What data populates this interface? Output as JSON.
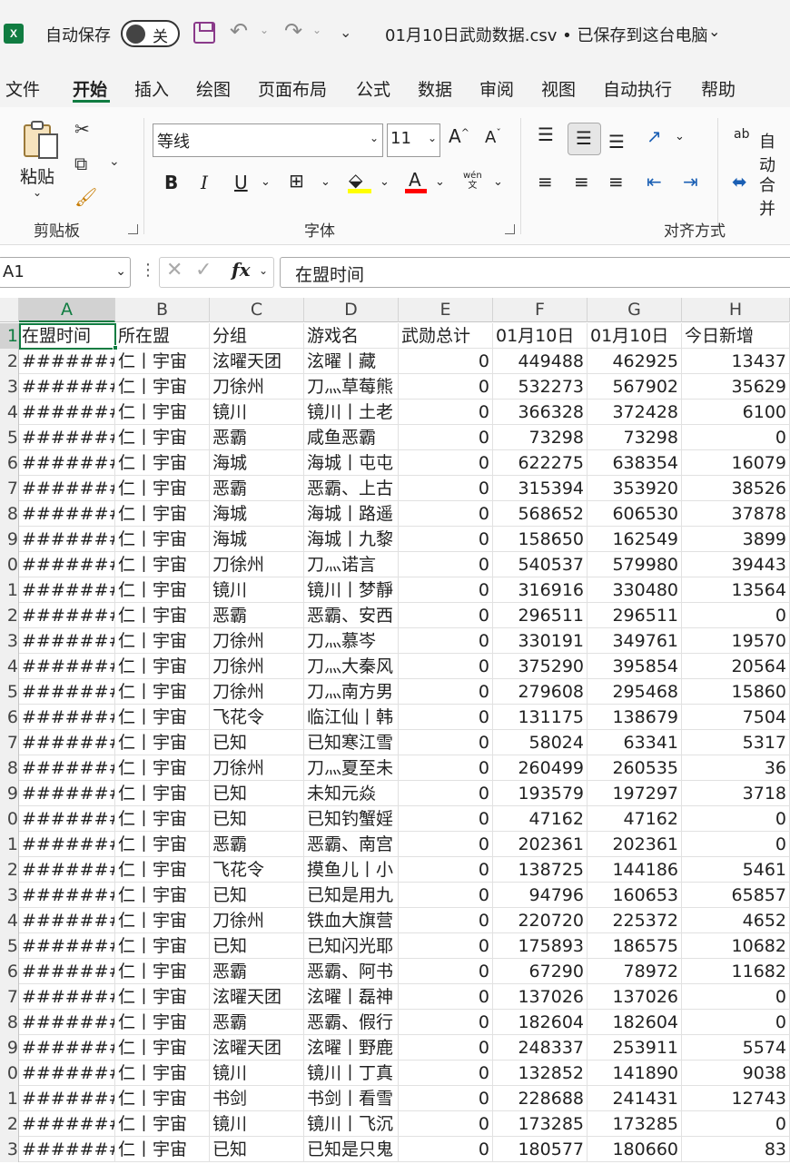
{
  "titlebar": {
    "app_logo": "X",
    "autosave_label": "自动保存",
    "autosave_state": "关",
    "save_icon": "save-icon",
    "undo_icon": "↶",
    "redo_icon": "↷",
    "qat_dropdown": "⌄",
    "document_title": "01月10日武勋数据.csv • 已保存到这台电脑",
    "title_chevron": "⌄"
  },
  "menu": {
    "tabs": [
      "文件",
      "开始",
      "插入",
      "绘图",
      "页面布局",
      "公式",
      "数据",
      "审阅",
      "视图",
      "自动执行",
      "帮助"
    ],
    "active_tab": "开始"
  },
  "ribbon": {
    "clipboard": {
      "paste_label": "粘贴",
      "group_label": "剪贴板"
    },
    "font": {
      "font_name": "等线",
      "font_size": "11",
      "grow_label": "A",
      "shrink_label": "A",
      "bold": "B",
      "italic": "I",
      "underline": "U",
      "font_color_glyph": "A",
      "phonetic_label": "wén",
      "phonetic_sub": "文",
      "group_label": "字体"
    },
    "alignment": {
      "wrap_label": "自动",
      "merge_label": "合并",
      "group_label": "对齐方式"
    }
  },
  "formula_bar": {
    "name_box": "A1",
    "fx_label": "fx",
    "formula": "在盟时间"
  },
  "sheet": {
    "column_letters": [
      "A",
      "B",
      "C",
      "D",
      "E",
      "F",
      "G",
      "H"
    ],
    "row_numbers": [
      "1",
      "2",
      "3",
      "4",
      "5",
      "6",
      "7",
      "8",
      "9",
      "0",
      "1",
      "2",
      "3",
      "4",
      "5",
      "6",
      "7",
      "8",
      "9",
      "0",
      "1",
      "2",
      "3",
      "4",
      "5",
      "6",
      "7",
      "8",
      "9",
      "0",
      "1",
      "2",
      "3"
    ],
    "header": [
      "在盟时间",
      "所在盟",
      "分组",
      "游戏名",
      "武勋总计",
      "01月10日",
      "01月10日",
      "今日新增"
    ],
    "rows": [
      [
        "#######",
        "仁丨宇宙",
        "泫曜天团",
        "泫曜丨藏",
        "0",
        "449488",
        "462925",
        "13437"
      ],
      [
        "#######",
        "仁丨宇宙",
        "刀徐州",
        "刀灬草莓熊",
        "0",
        "532273",
        "567902",
        "35629"
      ],
      [
        "#######",
        "仁丨宇宙",
        "镜川",
        "镜川丨土老",
        "0",
        "366328",
        "372428",
        "6100"
      ],
      [
        "#######",
        "仁丨宇宙",
        "恶霸",
        "咸鱼恶霸",
        "0",
        "73298",
        "73298",
        "0"
      ],
      [
        "#######",
        "仁丨宇宙",
        "海城",
        "海城丨屯屯",
        "0",
        "622275",
        "638354",
        "16079"
      ],
      [
        "#######",
        "仁丨宇宙",
        "恶霸",
        "恶霸、上古",
        "0",
        "315394",
        "353920",
        "38526"
      ],
      [
        "#######",
        "仁丨宇宙",
        "海城",
        "海城丨路遥",
        "0",
        "568652",
        "606530",
        "37878"
      ],
      [
        "#######",
        "仁丨宇宙",
        "海城",
        "海城丨九黎",
        "0",
        "158650",
        "162549",
        "3899"
      ],
      [
        "#######",
        "仁丨宇宙",
        "刀徐州",
        "刀灬诺言",
        "0",
        "540537",
        "579980",
        "39443"
      ],
      [
        "#######",
        "仁丨宇宙",
        "镜川",
        "镜川丨梦靜",
        "0",
        "316916",
        "330480",
        "13564"
      ],
      [
        "#######",
        "仁丨宇宙",
        "恶霸",
        "恶霸、安西",
        "0",
        "296511",
        "296511",
        "0"
      ],
      [
        "#######",
        "仁丨宇宙",
        "刀徐州",
        "刀灬慕岑",
        "0",
        "330191",
        "349761",
        "19570"
      ],
      [
        "#######",
        "仁丨宇宙",
        "刀徐州",
        "刀灬大秦风",
        "0",
        "375290",
        "395854",
        "20564"
      ],
      [
        "#######",
        "仁丨宇宙",
        "刀徐州",
        "刀灬南方男",
        "0",
        "279608",
        "295468",
        "15860"
      ],
      [
        "#######",
        "仁丨宇宙",
        "飞花令",
        "临江仙丨韩",
        "0",
        "131175",
        "138679",
        "7504"
      ],
      [
        "#######",
        "仁丨宇宙",
        "已知",
        "已知寒江雪",
        "0",
        "58024",
        "63341",
        "5317"
      ],
      [
        "#######",
        "仁丨宇宙",
        "刀徐州",
        "刀灬夏至未",
        "0",
        "260499",
        "260535",
        "36"
      ],
      [
        "#######",
        "仁丨宇宙",
        "已知",
        "未知元焱",
        "0",
        "193579",
        "197297",
        "3718"
      ],
      [
        "#######",
        "仁丨宇宙",
        "已知",
        "已知钓蟹婬",
        "0",
        "47162",
        "47162",
        "0"
      ],
      [
        "#######",
        "仁丨宇宙",
        "恶霸",
        "恶霸、南宫",
        "0",
        "202361",
        "202361",
        "0"
      ],
      [
        "#######",
        "仁丨宇宙",
        "飞花令",
        "摸鱼儿丨小",
        "0",
        "138725",
        "144186",
        "5461"
      ],
      [
        "#######",
        "仁丨宇宙",
        "已知",
        "已知是用九",
        "0",
        "94796",
        "160653",
        "65857"
      ],
      [
        "#######",
        "仁丨宇宙",
        "刀徐州",
        "铁血大旗营",
        "0",
        "220720",
        "225372",
        "4652"
      ],
      [
        "#######",
        "仁丨宇宙",
        "已知",
        "已知闪光耶",
        "0",
        "175893",
        "186575",
        "10682"
      ],
      [
        "#######",
        "仁丨宇宙",
        "恶霸",
        "恶霸、阿书",
        "0",
        "67290",
        "78972",
        "11682"
      ],
      [
        "#######",
        "仁丨宇宙",
        "泫曜天团",
        "泫曜丨磊神",
        "0",
        "137026",
        "137026",
        "0"
      ],
      [
        "#######",
        "仁丨宇宙",
        "恶霸",
        "恶霸、假行",
        "0",
        "182604",
        "182604",
        "0"
      ],
      [
        "#######",
        "仁丨宇宙",
        "泫曜天团",
        "泫曜丨野鹿",
        "0",
        "248337",
        "253911",
        "5574"
      ],
      [
        "#######",
        "仁丨宇宙",
        "镜川",
        "镜川丨丁真",
        "0",
        "132852",
        "141890",
        "9038"
      ],
      [
        "#######",
        "仁丨宇宙",
        "书剑",
        "书剑丨看雪",
        "0",
        "228688",
        "241431",
        "12743"
      ],
      [
        "#######",
        "仁丨宇宙",
        "镜川",
        "镜川丨飞沉",
        "0",
        "173285",
        "173285",
        "0"
      ],
      [
        "#######",
        "仁丨宇宙",
        "已知",
        "已知是只鬼",
        "0",
        "180577",
        "180660",
        "83"
      ]
    ]
  },
  "colors": {
    "accent": "#107c41",
    "save_purple": "#8a3a8a",
    "highlight_yellow": "#ffff00",
    "font_red": "#ff0000"
  }
}
